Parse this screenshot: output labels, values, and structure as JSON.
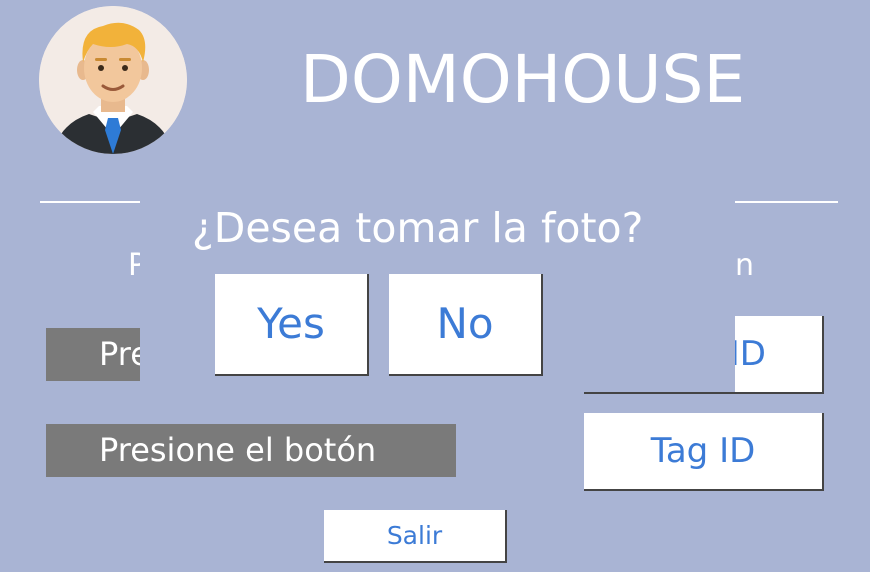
{
  "app": {
    "title": "DOMOHOUSE"
  },
  "left_panel": {
    "label_partial": "P",
    "button1_partial": "Pre",
    "button2_label": "Presione el botón"
  },
  "right_panel": {
    "label_partial": "n",
    "button1_partial": "ID",
    "button2_label": "Tag ID"
  },
  "exit_button": {
    "label": "Salir"
  },
  "dialog": {
    "question": "¿Desea tomar la foto?",
    "yes_label": "Yes",
    "no_label": "No"
  },
  "colors": {
    "background": "#a9b4d4",
    "gray_button": "#7a7a7a",
    "accent_text": "#3c7bd6",
    "white": "#ffffff"
  },
  "icons": {
    "avatar": "user-avatar-icon"
  }
}
